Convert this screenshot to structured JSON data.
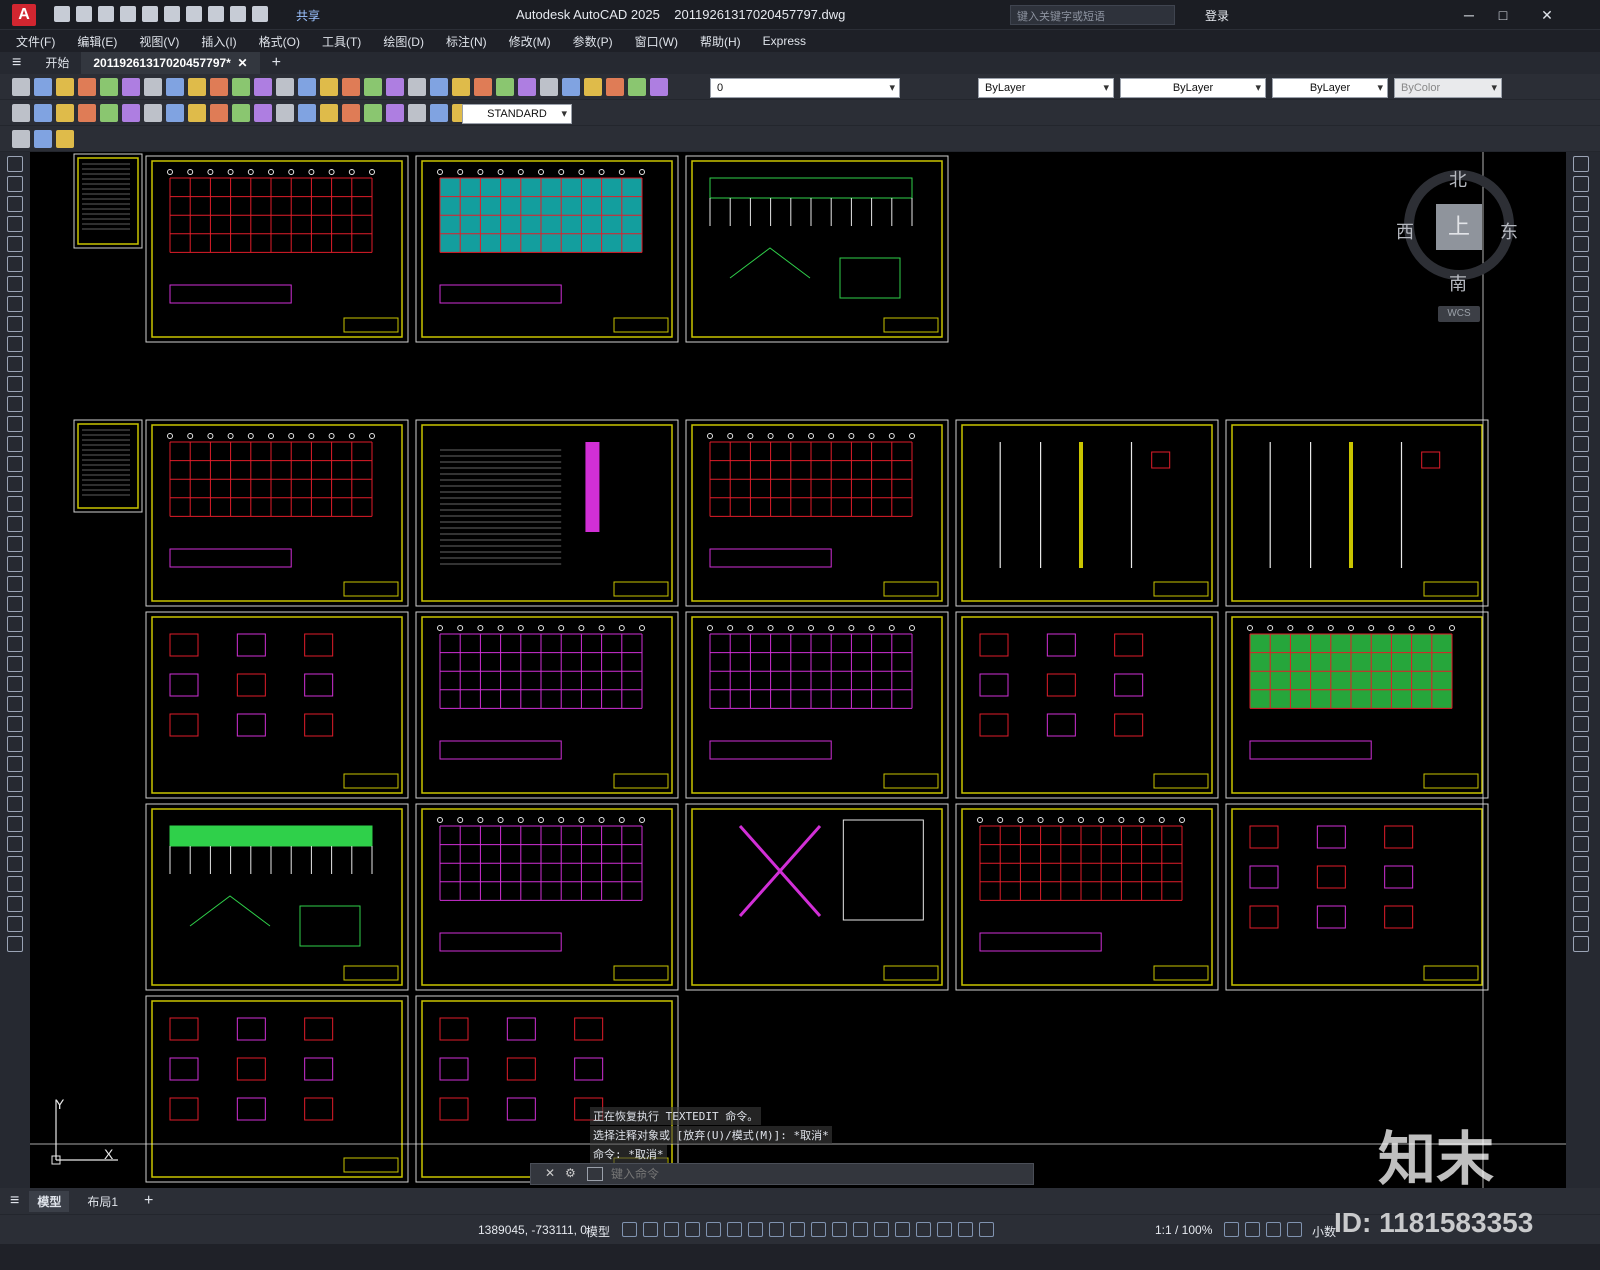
{
  "app": {
    "logo": "A",
    "title": "Autodesk AutoCAD 2025",
    "filename": "20119261317020457797.dwg",
    "share_label": "共享",
    "search_placeholder": "键入关键字或短语",
    "login_label": "登录",
    "minimize": "─",
    "maximize": "□",
    "close": "✕"
  },
  "menu": [
    "文件(F)",
    "编辑(E)",
    "视图(V)",
    "插入(I)",
    "格式(O)",
    "工具(T)",
    "绘图(D)",
    "标注(N)",
    "修改(M)",
    "参数(P)",
    "窗口(W)",
    "帮助(H)",
    "Express"
  ],
  "tabs": {
    "start": "开始",
    "doc": "20119261317020457797*",
    "close": "✕",
    "add": "+"
  },
  "toolbar": {
    "layer_value": "0",
    "color_value": "ByLayer",
    "linetype_value": "ByLayer",
    "lineweight_value": "ByLayer",
    "plotstyle_value": "ByColor",
    "textstyle_value": "STANDARD"
  },
  "viewcube": {
    "north": "北",
    "south": "南",
    "west": "西",
    "east": "东",
    "face": "上",
    "wcs": "WCS"
  },
  "ucs": {
    "y": "Y",
    "x": "X"
  },
  "command": {
    "line1": "正在恢复执行 TEXTEDIT 命令。",
    "line2": "选择注释对象或 [放弃(U)/模式(M)]: *取消*",
    "line3": "命令: *取消*",
    "placeholder": "键入命令"
  },
  "layouts": {
    "model": "模型",
    "layout1": "布局1",
    "add": "+"
  },
  "status": {
    "coords": "1389045, -733111, 0",
    "model": "模型",
    "scale": "1:1 / 100%",
    "units": "小数"
  },
  "watermark": {
    "brand": "知末",
    "id": "ID: 1181583353"
  },
  "colors": {
    "canvas": "#000000",
    "frame": "#c9c400",
    "red": "#e11d2a",
    "magenta": "#d12fd6",
    "cyan": "#18c6c6",
    "green": "#2fd04a",
    "white": "#e8e8e8"
  }
}
